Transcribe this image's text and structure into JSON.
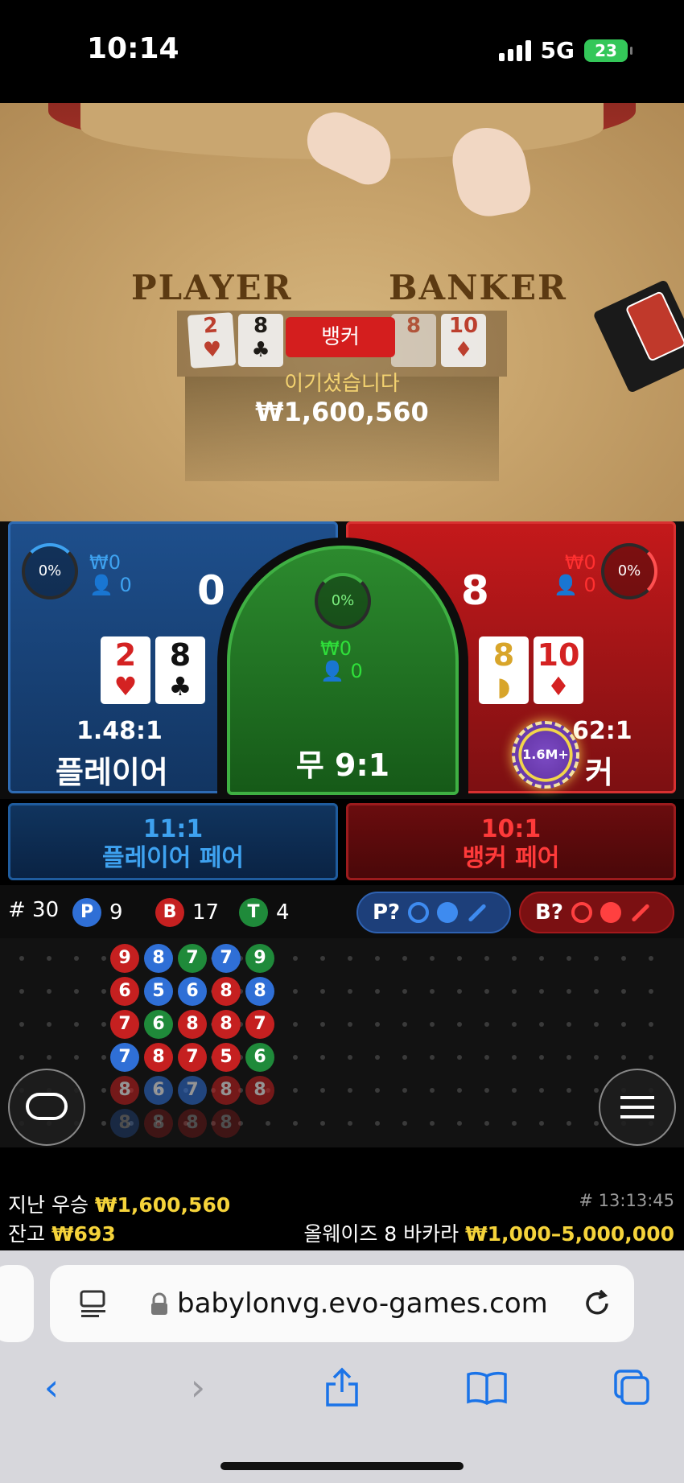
{
  "status_bar": {
    "time": "10:14",
    "network": "5G",
    "battery": "23"
  },
  "video": {
    "label_player": "PLAYER",
    "label_banker": "BANKER",
    "result_banner": "뱅커",
    "win_text": "이기셨습니다",
    "win_amount": "₩1,600,560",
    "player_cards": [
      {
        "rank": "2",
        "suit": "♥",
        "color": "red"
      },
      {
        "rank": "8",
        "suit": "♣",
        "color": "black"
      }
    ],
    "banker_cards": [
      {
        "rank": "8",
        "suit": "",
        "color": "red"
      },
      {
        "rank": "10",
        "suit": "♦",
        "color": "red"
      }
    ]
  },
  "bets": {
    "player": {
      "percent": "0%",
      "amount": "₩0",
      "players": "0",
      "score": "0",
      "cards": [
        {
          "rank": "2",
          "suit": "♥"
        },
        {
          "rank": "8",
          "suit": "♣"
        }
      ],
      "odds": "1.48:1",
      "label": "플레이어"
    },
    "tie": {
      "percent": "0%",
      "amount": "₩0",
      "players": "0",
      "label": "무 9:1"
    },
    "banker": {
      "percent": "0%",
      "amount": "₩0",
      "players": "0",
      "score": "8",
      "cards": [
        {
          "rank": "8",
          "suit": ""
        },
        {
          "rank": "10",
          "suit": "♦"
        }
      ],
      "odds": "62:1",
      "label": "커",
      "chip": "1.6M+"
    },
    "player_pair": {
      "odds": "11:1",
      "label": "플레이어 페어"
    },
    "banker_pair": {
      "odds": "10:1",
      "label": "뱅커 페어"
    }
  },
  "stats": {
    "round": "# 30",
    "player_letter": "P",
    "player_count": "9",
    "banker_letter": "B",
    "banker_count": "17",
    "tie_letter": "T",
    "tie_count": "4",
    "predict_player": "P?",
    "predict_banker": "B?"
  },
  "road": {
    "columns": [
      [
        "9",
        "6",
        "7",
        "7",
        "8",
        "8"
      ],
      [
        "8",
        "5",
        "6",
        "8",
        "6",
        "8"
      ],
      [
        "7",
        "6",
        "8",
        "7",
        "7",
        "8"
      ],
      [
        "7",
        "8",
        "8",
        "5",
        "8",
        "8"
      ],
      [
        "9",
        "8",
        "7",
        "6",
        "8",
        ""
      ]
    ],
    "results": [
      [
        "B",
        "B",
        "B",
        "P",
        "B",
        "P"
      ],
      [
        "P",
        "P",
        "T",
        "B",
        "P",
        "B"
      ],
      [
        "T",
        "P",
        "B",
        "B",
        "P",
        "B"
      ],
      [
        "P",
        "B",
        "B",
        "B",
        "B",
        "B"
      ],
      [
        "T",
        "P",
        "B",
        "T",
        "B",
        ""
      ]
    ]
  },
  "info": {
    "last_win_label": "지난 우승",
    "last_win_value": "₩1,600,560",
    "balance_label": "잔고",
    "balance_value": "₩693",
    "game_id": "# 13:13:45",
    "table_name": "올웨이즈 8 바카라",
    "limits": "₩1,000–5,000,000"
  },
  "browser": {
    "url": "babylonvg.evo-games.com"
  },
  "colors": {
    "player": "#1e4f8c",
    "banker": "#c4191b",
    "tie": "#2c8a2e",
    "accent_yellow": "#f5d33a"
  }
}
